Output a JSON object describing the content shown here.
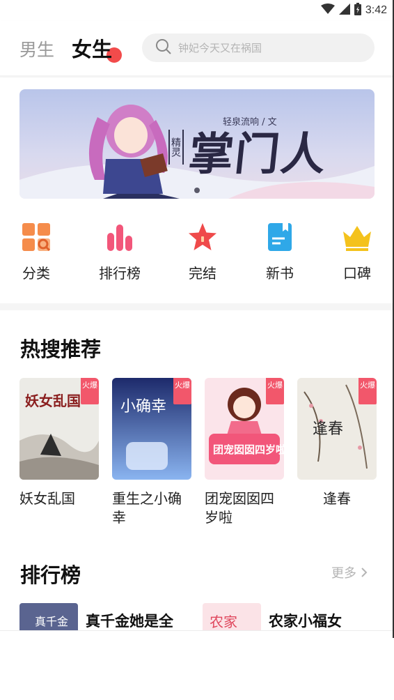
{
  "status_bar": {
    "time": "3:42"
  },
  "header": {
    "tab_male": "男生",
    "tab_female": "女生",
    "search_placeholder": "钟妃今天又在祸国"
  },
  "banner": {
    "author": "轻泉流响 / 文",
    "tag": "精灵",
    "title": "掌门人"
  },
  "categories": [
    {
      "label": "分类",
      "icon": "category-grid-icon"
    },
    {
      "label": "排行榜",
      "icon": "ranking-bars-icon"
    },
    {
      "label": "完结",
      "icon": "star-icon"
    },
    {
      "label": "新书",
      "icon": "new-book-icon"
    },
    {
      "label": "口碑",
      "icon": "crown-icon"
    }
  ],
  "hot_search": {
    "title": "热搜推荐",
    "badge": "火爆",
    "books": [
      {
        "title": "妖女乱国",
        "cover_text": "妖女乱国"
      },
      {
        "title": "重生之小确幸",
        "cover_text": "小确幸"
      },
      {
        "title": "团宠囡囡四岁啦",
        "cover_text": "团宠囡囡四岁啦"
      },
      {
        "title": "逢春",
        "cover_text": "逢春"
      }
    ]
  },
  "ranking": {
    "title": "排行榜",
    "more": "更多",
    "items": [
      {
        "title": "真千金她是全",
        "cover_text": "真千金"
      },
      {
        "title": "农家小福女",
        "cover_text": "农家"
      }
    ]
  },
  "colors": {
    "accent_red": "#f24b4b",
    "badge_red": "#f2576b",
    "category_orange": "#f58c4b",
    "category_pink": "#f2567a",
    "category_star_red": "#ef4a4a",
    "category_blue": "#2fa8e8",
    "category_gold": "#f4c21c"
  }
}
